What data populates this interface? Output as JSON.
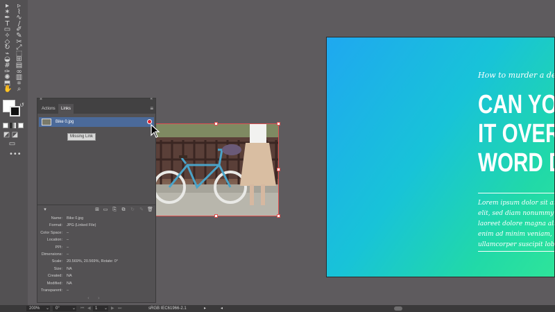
{
  "tools": {
    "icons": [
      "selection-tool-icon",
      "direct-selection-tool-icon",
      "magic-wand-icon",
      "lasso-icon",
      "pen-tool-icon",
      "curvature-tool-icon",
      "type-tool-icon",
      "line-tool-icon",
      "rectangle-tool-icon",
      "paintbrush-icon",
      "shaper-tool-icon",
      "pencil-icon",
      "eraser-icon",
      "scissors-icon",
      "rotate-icon",
      "scale-icon",
      "width-tool-icon",
      "free-transform-icon",
      "shape-builder-icon",
      "perspective-grid-icon",
      "mesh-tool-icon",
      "gradient-icon",
      "eyedropper-icon",
      "blend-icon",
      "symbol-sprayer-icon",
      "column-graph-icon",
      "artboard-tool-icon",
      "slice-icon",
      "hand-icon",
      "zoom-icon"
    ],
    "more": "•••"
  },
  "artboard": {
    "subtitle": "How to murder a desig",
    "headline": [
      "CAN YOU",
      "IT OVER A",
      "WORD DO"
    ],
    "body": [
      "Lorem ipsum dolor sit ame",
      "elit, sed diam nonummy ni",
      "laoreet dolore magna aliqu",
      "enim ad minim veniam, qu",
      "ullamcorper suscipit lobort"
    ]
  },
  "links_panel": {
    "close": "×",
    "collapse": "«",
    "tabs": [
      {
        "label": "Actions"
      },
      {
        "label": "Links"
      }
    ],
    "menu": "≡",
    "item": {
      "name": "Bike 0.jpg"
    },
    "tooltip": "Missing Link",
    "info": [
      {
        "label": "Name:",
        "value": "Bike 0.jpg"
      },
      {
        "label": "Format:",
        "value": "JPG (Linked File)"
      },
      {
        "label": "Color Space:",
        "value": "–"
      },
      {
        "label": "Location:",
        "value": "–"
      },
      {
        "label": "PPI:",
        "value": "–"
      },
      {
        "label": "Dimensions:",
        "value": "–"
      },
      {
        "label": "Scale:",
        "value": "20.569%, 20.569%, Rotate: 0°"
      },
      {
        "label": "Size:",
        "value": "NA"
      },
      {
        "label": "Created:",
        "value": "NA"
      },
      {
        "label": "Modified:",
        "value": "NA"
      },
      {
        "label": "Transparent:",
        "value": "–"
      }
    ],
    "nav_prev": "‹",
    "nav_next": "›"
  },
  "statusbar": {
    "zoom": "200%",
    "rotation": "0°",
    "artboard_number": "1",
    "profile": "sRGB IEC61966-2.1"
  },
  "colors": {
    "missing": "#e0222f",
    "selection": "#e05050",
    "row_selected": "#4b6a9a"
  }
}
